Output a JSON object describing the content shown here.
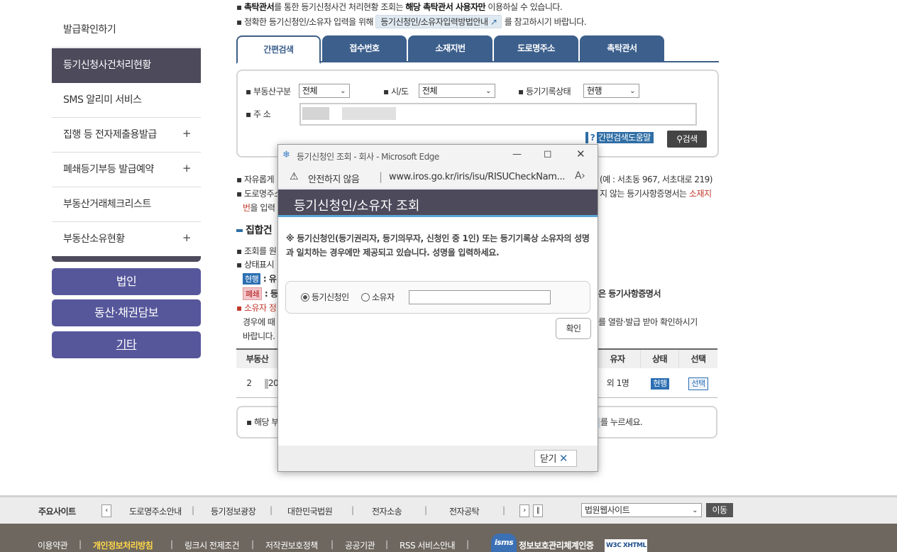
{
  "sidebar": {
    "items": [
      {
        "label": "발급확인하기",
        "expandable": false
      },
      {
        "label": "등기신청사건처리현황",
        "expandable": false,
        "active": true
      },
      {
        "label": "SMS 알리미 서비스",
        "expandable": false
      },
      {
        "label": "집행 등 전자제출용발급",
        "expandable": true
      },
      {
        "label": "폐쇄등기부등 발급예약",
        "expandable": true
      },
      {
        "label": "부동산거래체크리스트",
        "expandable": false
      },
      {
        "label": "부동산소유현황",
        "expandable": true
      }
    ],
    "plus_symbol": "+",
    "big_buttons": [
      "법인",
      "동산·채권담보",
      "기타"
    ]
  },
  "notes": {
    "line1_pre": "▪ ",
    "line1_bold1": "촉탁관서",
    "line1_mid": "를 통한 등기신청사건 처리현황 조회는 ",
    "line1_bold2": "해당 촉탁관서 사용자만",
    "line1_post": " 이용하실 수 있습니다.",
    "line2_pre": "▪ 정확한 등기신청인/소유자 입력을 위해 ",
    "line2_chip": "등기신청인/소유자입력방법안내",
    "line2_post": " 를 참고하시기 바랍니다."
  },
  "tabs": [
    "간편검색",
    "접수번호",
    "소재지번",
    "도로명주소",
    "촉탁관서"
  ],
  "search": {
    "property_type_label": "▪ 부동산구분",
    "property_type_value": "전체",
    "city_label": "▪ 시/도",
    "city_value": "전체",
    "record_status_label": "▪ 등기기록상태",
    "record_status_value": "현행",
    "address_label": "▪ 주 소",
    "help_label": "간편검색도움말",
    "search_button": "검색"
  },
  "main_text": {
    "free_input_a": "▪ 자유롭게 ",
    "free_input_b": "(예 : 서초동 967, 서초대로 219)",
    "road_a": "▪ 도로명주소",
    "road_b": "지 않는 등기사항증명서는 ",
    "road_red": "소재지",
    "road_c": "번",
    "road_d": "을 입력",
    "section_title": "집합건",
    "view_note": "▪ 조회를 원",
    "status_note": "▪ 상태표시",
    "badge_current": "현행",
    "badge_current_text": " : 유",
    "badge_closed": "폐쇄",
    "badge_closed_text": " : 등",
    "closed_suffix": "은 등기사항증명서",
    "owner_red": "▪ 소유자  정",
    "owner_line_tail": "를  열람·발급  받아  확인하시기",
    "owner_line2_a": "경우에  때",
    "owner_line3": "바랍니다.",
    "bottom_note_a": "▪ 해당 부",
    "bottom_note_b": "를 누르세요."
  },
  "table": {
    "headers": [
      "부동산",
      "유자",
      "상태",
      "선택"
    ],
    "row": {
      "num": "2",
      "addr_partial": "20",
      "owner": "외 1명",
      "status": "현행",
      "select": "선택"
    }
  },
  "popup": {
    "window_title": "등기신청인 조회 - 회사 - Microsoft Edge",
    "insecure_label": "안전하지 않음",
    "url": "www.iros.go.kr/iris/isu/RISUCheckNam...",
    "header": "등기신청인/소유자 조회",
    "notice": "※ 등기신청인(등기권리자, 등기의무자, 신청인 중 1인) 또는 등기기록상 소유자의 성명과 일치하는 경우에만 제공되고 있습니다. 성명을 입력하세요.",
    "radio_applicant": "등기신청인",
    "radio_owner": "소유자",
    "name_value": "",
    "confirm_button": "확인",
    "close_button": "닫기"
  },
  "footer": {
    "sites_label": "주요사이트",
    "sites": [
      "도로명주소안내",
      "등기정보광장",
      "대한민국법원",
      "전자소송",
      "전자공탁"
    ],
    "site_select": "법원웹사이트",
    "go_button": "이동",
    "links": [
      "이용약관",
      "개인정보처리방침",
      "링크시 전제조건",
      "저작권보호정책",
      "공공기관",
      "RSS 서비스안내"
    ],
    "isms_label": "정보보호관리체계인증",
    "w3c_label": "W3C XHTML 1.0"
  },
  "colors": {
    "sidebar_active": "#4c4a5b",
    "big_button": "#56579b",
    "tab_blue": "#3c5f8c",
    "popup_header": "#4c4a5b",
    "highlight_link": "#ffd84a"
  }
}
